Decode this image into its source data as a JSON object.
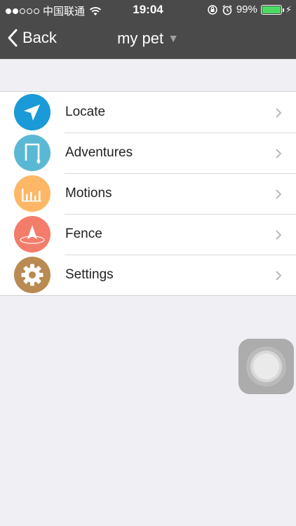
{
  "status_bar": {
    "carrier": "中国联通",
    "time": "19:04",
    "battery_percent": "99%",
    "battery_level": 0.99,
    "battery_color": "#4cd964"
  },
  "nav": {
    "back_label": "Back",
    "title": "my pet",
    "title_caret": "▼"
  },
  "menu": {
    "items": [
      {
        "label": "Locate",
        "icon": "locate-arrow-icon",
        "color": "#1a9ad6"
      },
      {
        "label": "Adventures",
        "icon": "adventures-path-icon",
        "color": "#5bb8d4"
      },
      {
        "label": "Motions",
        "icon": "motions-bars-icon",
        "color": "#fdb766"
      },
      {
        "label": "Fence",
        "icon": "fence-pin-icon",
        "color": "#f47c6a"
      },
      {
        "label": "Settings",
        "icon": "gear-icon",
        "color": "#b98a52"
      }
    ]
  }
}
